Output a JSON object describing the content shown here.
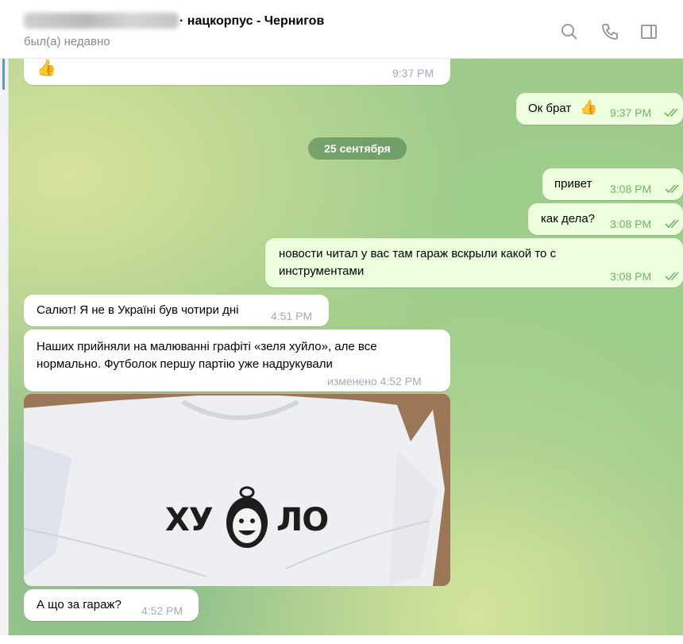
{
  "header": {
    "title": "· нацкорпус - Чернигов",
    "status": "был(а) недавно",
    "icons": [
      "search-icon",
      "phone-icon",
      "sidebar-toggle-icon",
      "more-icon"
    ]
  },
  "date_separator": "25 сентября",
  "messages": [
    {
      "id": "m1",
      "direction": "in",
      "text": "",
      "emoji": "👍",
      "time": "9:37 PM"
    },
    {
      "id": "m2",
      "direction": "out",
      "text": "Ок брат",
      "emoji": "👍",
      "time": "9:37 PM",
      "read": true
    },
    {
      "id": "m3",
      "direction": "out",
      "text": "привет",
      "time": "3:08 PM",
      "read": true
    },
    {
      "id": "m4",
      "direction": "out",
      "text": "как дела?",
      "time": "3:08 PM",
      "read": true
    },
    {
      "id": "m5",
      "direction": "out",
      "lines": [
        "новости читал у вас там гараж вскрыли какой то с",
        "инструментами"
      ],
      "time": "3:08 PM",
      "read": true
    },
    {
      "id": "m6",
      "direction": "in",
      "text": "Салют! Я не в Україні був чотири дні",
      "time": "4:51 PM"
    },
    {
      "id": "m7",
      "direction": "in",
      "lines": [
        "Наших прийняли на малюванні графіті «зеля хуйло», але все",
        "нормально. Футболок першу партію уже надрукували"
      ],
      "time": "изменено 4:52 PM"
    },
    {
      "id": "m8",
      "direction": "in",
      "type": "photo",
      "print_left": "ХУ",
      "print_right": "ЛО"
    },
    {
      "id": "m9",
      "direction": "in",
      "text": "А що за гараж?",
      "time": "4:52 PM"
    }
  ],
  "colors": {
    "incoming": "#ffffff",
    "outgoing": "#eeffde",
    "outgoing_time": "#6cb567",
    "incoming_time": "#a0acb6"
  }
}
